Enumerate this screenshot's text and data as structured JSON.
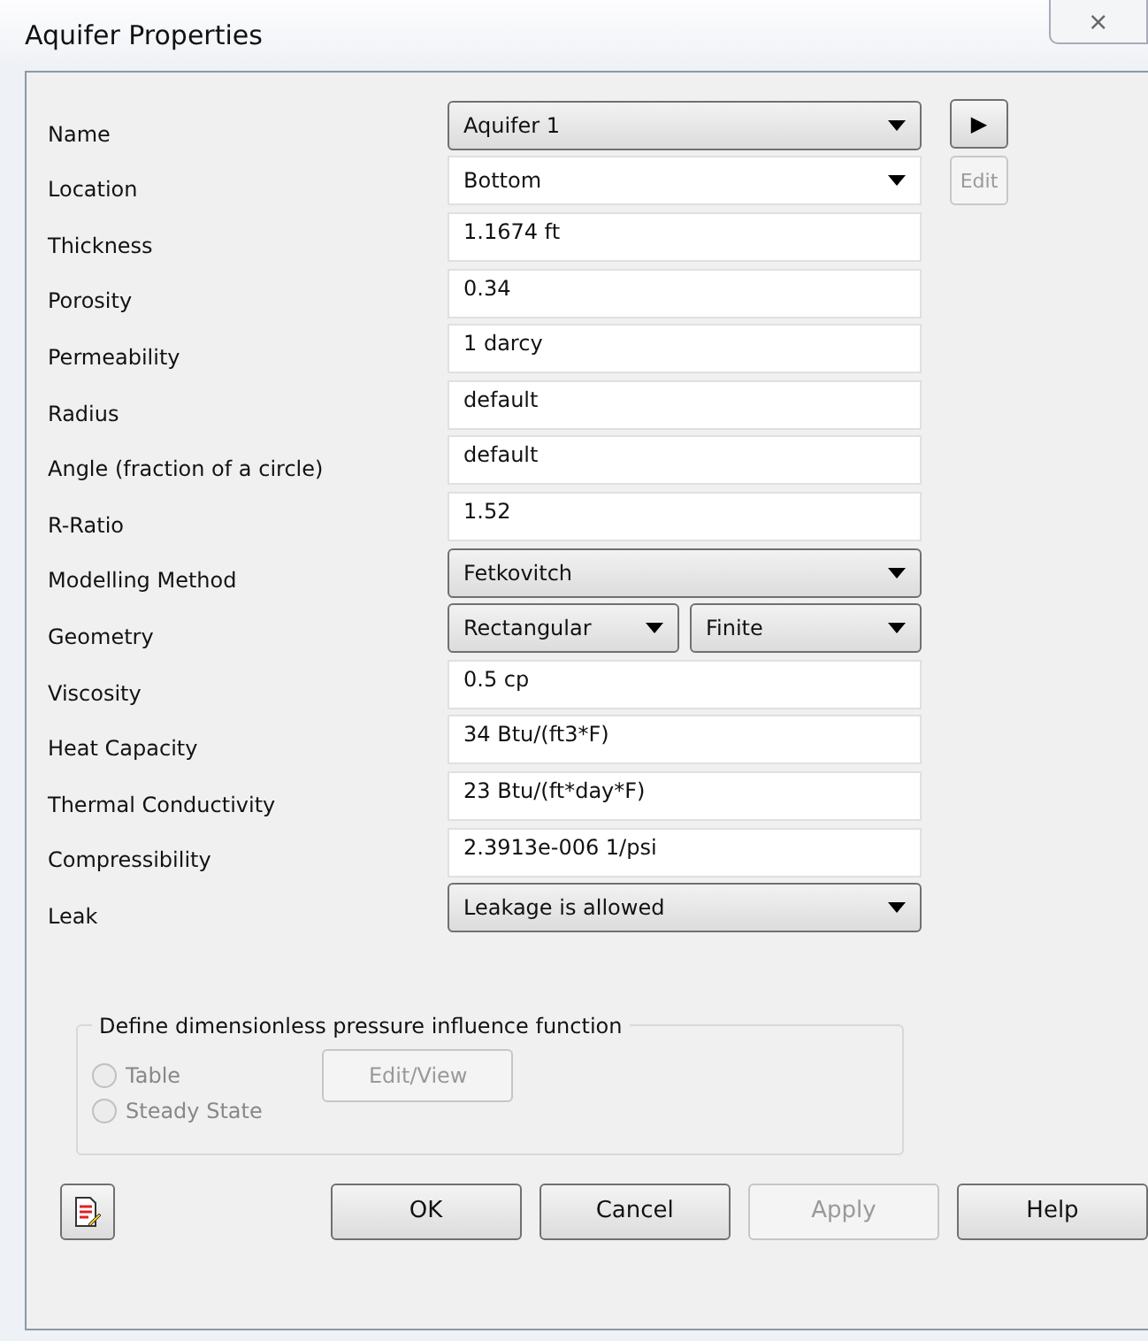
{
  "window": {
    "title": "Aquifer Properties",
    "close": "⨯"
  },
  "side_buttons": [
    {
      "label": "▶",
      "disabled": false
    },
    {
      "label": "Edit",
      "disabled": true
    }
  ],
  "rows": [
    {
      "label": "Name",
      "kind": "dropdown",
      "values": [
        "Aquifer 1"
      ]
    },
    {
      "label": "Location",
      "kind": "combo",
      "values": [
        "Bottom"
      ]
    },
    {
      "label": "Thickness",
      "kind": "text",
      "values": [
        "1.1674 ft"
      ]
    },
    {
      "label": "Porosity",
      "kind": "text",
      "values": [
        "0.34"
      ]
    },
    {
      "label": "Permeability",
      "kind": "text",
      "values": [
        "1 darcy"
      ]
    },
    {
      "label": "Radius",
      "kind": "text",
      "values": [
        "default"
      ]
    },
    {
      "label": "Angle (fraction of a circle)",
      "kind": "text",
      "values": [
        "default"
      ]
    },
    {
      "label": "R-Ratio",
      "kind": "text",
      "values": [
        "1.52"
      ]
    },
    {
      "label": "Modelling Method",
      "kind": "dropdown",
      "values": [
        "Fetkovitch"
      ]
    },
    {
      "label": "Geometry",
      "kind": "dropdown",
      "values": [
        "Rectangular",
        "Finite"
      ]
    },
    {
      "label": "Viscosity",
      "kind": "text",
      "values": [
        "0.5 cp"
      ]
    },
    {
      "label": "Heat Capacity",
      "kind": "text",
      "values": [
        "34 Btu/(ft3*F)"
      ]
    },
    {
      "label": "Thermal Conductivity",
      "kind": "text",
      "values": [
        "23 Btu/(ft*day*F)"
      ]
    },
    {
      "label": "Compressibility",
      "kind": "text",
      "values": [
        "2.3913e-006 1/psi"
      ]
    },
    {
      "label": "Leak",
      "kind": "dropdown",
      "values": [
        "Leakage is allowed"
      ]
    }
  ],
  "group": {
    "title": "Define dimensionless pressure influence function",
    "options": [
      {
        "label": "Table",
        "selected": false,
        "disabled": true
      },
      {
        "label": "Steady State",
        "selected": false,
        "disabled": true
      }
    ],
    "button": {
      "label": "Edit/View",
      "disabled": true
    }
  },
  "buttons": [
    {
      "label": "OK",
      "disabled": false
    },
    {
      "label": "Cancel",
      "disabled": false
    },
    {
      "label": "Apply",
      "disabled": true
    },
    {
      "label": "Help",
      "disabled": false
    }
  ]
}
